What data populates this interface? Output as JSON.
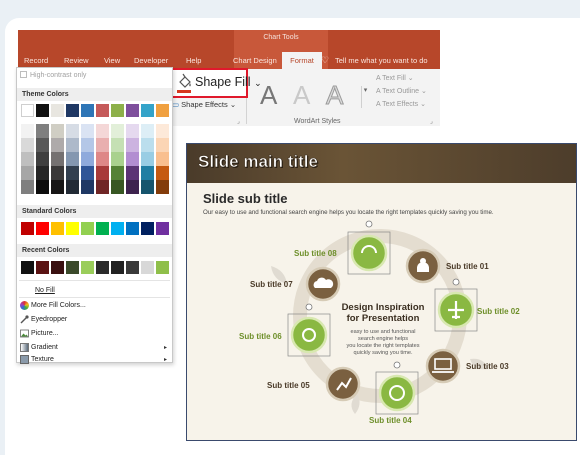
{
  "ribbon": {
    "chart_tools_label": "Chart Tools",
    "tabs": [
      "Record",
      "Review",
      "View",
      "Developer",
      "Help",
      "Chart Design",
      "Format"
    ],
    "active_tab": "Format",
    "tell_me": "Tell me what you want to do",
    "shape_fill_label": "Shape Fill",
    "shape_fill_chevron": "⌄",
    "shape_effects_label": "Shape Effects ⌄",
    "wordart_letter": "A",
    "wordart_label": "WordArt Styles",
    "text_fill": "Text Fill ⌄",
    "text_outline": "Text Outline ⌄",
    "text_effects": "Text Effects ⌄",
    "accent_color": "#b7472a"
  },
  "dropdown": {
    "high_contrast": "High-contrast only",
    "theme_colors_label": "Theme Colors",
    "standard_colors_label": "Standard Colors",
    "recent_colors_label": "Recent Colors",
    "theme_top": [
      "#ffffff",
      "#000000",
      "#e7e6e6",
      "#44546a",
      "#4472c4",
      "#ed7d31",
      "#a5a5a5",
      "#ffc000",
      "#5b9bd5",
      "#70ad47"
    ],
    "theme_top_visible": [
      "#ffffff",
      "#111111",
      "#e8e6e0",
      "#1f3864",
      "#2e75b6",
      "#c55a5a",
      "#8db04a",
      "#7e4f9c",
      "#34a3c9",
      "#f0a040"
    ],
    "theme_shades": [
      [
        "#f2f2f2",
        "#7f7f7f",
        "#d0cec4",
        "#d6dce5",
        "#dae3f3",
        "#f4d7d7",
        "#e2efd9",
        "#e5d9ef",
        "#ddeef6",
        "#fde9d9"
      ],
      [
        "#d9d9d9",
        "#595959",
        "#aeaaaa",
        "#adb9ca",
        "#b4c7e7",
        "#e9afaf",
        "#c5e0b4",
        "#ccb3e0",
        "#bbdeed",
        "#fbd5b5"
      ],
      [
        "#bfbfbf",
        "#3f3f3f",
        "#757171",
        "#8497b0",
        "#8faadc",
        "#de8787",
        "#a9d18e",
        "#b28dd1",
        "#99cde4",
        "#f9bf8f"
      ],
      [
        "#a6a6a6",
        "#262626",
        "#3a3838",
        "#323f4f",
        "#2f5597",
        "#a83a3a",
        "#548235",
        "#5b3475",
        "#217ea3",
        "#c55a11"
      ],
      [
        "#7f7f7f",
        "#0d0d0d",
        "#171616",
        "#222a35",
        "#1f3864",
        "#702626",
        "#385723",
        "#3d234e",
        "#16546d",
        "#833c0b"
      ]
    ],
    "standard_colors": [
      "#c00000",
      "#ff0000",
      "#ffc000",
      "#ffff00",
      "#92d050",
      "#00b050",
      "#00b0f0",
      "#0070c0",
      "#002060",
      "#7030a0"
    ],
    "recent_colors": [
      "#111111",
      "#5a1212",
      "#3a1010",
      "#3b4a2a",
      "#9acd5a",
      "#2a2a2a",
      "#222222",
      "#3a3a3a",
      "#d8d8d8",
      "#8fbf4a"
    ],
    "no_fill": "No Fill",
    "more_colors": "More Fill Colors...",
    "eyedropper": "Eyedropper",
    "picture": "Picture...",
    "gradient": "Gradient",
    "texture": "Texture"
  },
  "slide": {
    "title": "Slide main title",
    "subtitle": "Slide sub title",
    "description": "Our easy to use and functional search engine helps you locate the right templates quickly  saving you time.",
    "center_title_1": "Design Inspiration",
    "center_title_2": "for Presentation",
    "center_body_1": "easy to use and functional",
    "center_body_2": "search engine helps",
    "center_body_3": "you locate the right templates",
    "center_body_4": "quickly saving you time.",
    "labels": [
      "Sub title 01",
      "Sub title 02",
      "Sub title 03",
      "Sub title 04",
      "Sub title 05",
      "Sub title 06",
      "Sub title 07",
      "Sub title 08"
    ],
    "brown": "#7a6040",
    "green": "#8ab842",
    "label_green": "#6e8f2a",
    "label_dark": "#4a3a28"
  }
}
